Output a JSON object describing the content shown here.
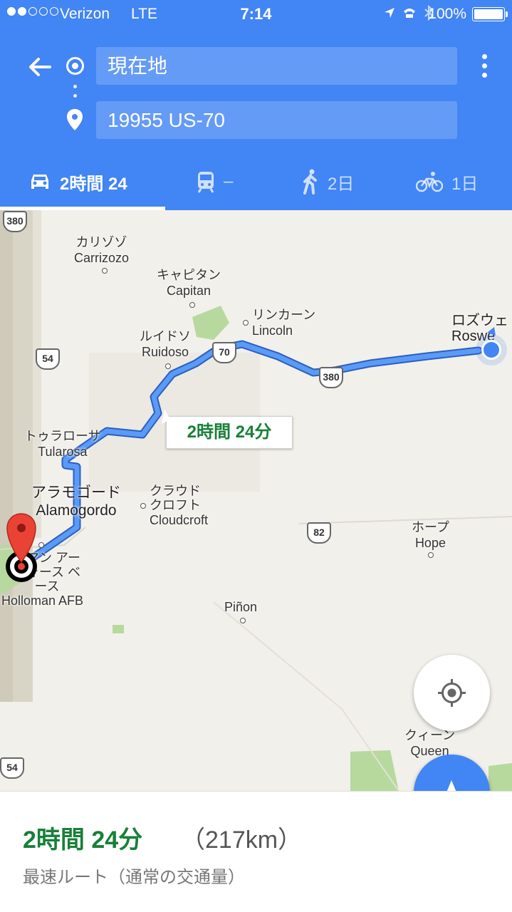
{
  "status_bar": {
    "carrier": "Verizon",
    "network": "LTE",
    "time": "7:14",
    "battery": "100%"
  },
  "header": {
    "origin": "現在地",
    "destination": "19955 US-70"
  },
  "travel_modes": [
    {
      "mode": "drive",
      "icon": "car-icon",
      "label": "2時間 24",
      "active": true
    },
    {
      "mode": "transit",
      "icon": "train-icon",
      "label": "–",
      "active": false
    },
    {
      "mode": "walk",
      "icon": "walk-icon",
      "label": "2日",
      "active": false
    },
    {
      "mode": "bike",
      "icon": "bike-icon",
      "label": "1日",
      "active": false
    }
  ],
  "map": {
    "route_callout": "2時間 24分",
    "places": [
      {
        "jp": "カリゾゾ",
        "en": "Carrizozo"
      },
      {
        "jp": "キャピタン",
        "en": "Capitan"
      },
      {
        "jp": "リンカーン",
        "en": "Lincoln"
      },
      {
        "jp": "ルイドソ",
        "en": "Ruidoso"
      },
      {
        "jp": "ロズウェ",
        "en": "Roswe"
      },
      {
        "jp": "トゥラローサ",
        "en": "Tularosa"
      },
      {
        "jp": "アラモゴード",
        "en": "Alamogordo"
      },
      {
        "jp": "クラウド クロフト",
        "en": "Cloudcroft"
      },
      {
        "jp": "ホープ",
        "en": "Hope"
      },
      {
        "jp": "ーマン アー フォース ベース",
        "en": "Holloman AFB"
      },
      {
        "jp": "",
        "en": "Piñon"
      },
      {
        "jp": "クィーン",
        "en": "Queen"
      }
    ],
    "shields": [
      "380",
      "54",
      "70",
      "380",
      "82",
      "54"
    ]
  },
  "summary": {
    "duration": "2時間 24分",
    "distance": "（217km）",
    "route_note": "最速ルート（通常の交通量）"
  },
  "colors": {
    "header_blue": "#4285f4",
    "route_blue": "#4285f4",
    "duration_green": "#188038",
    "pin_red": "#ea4335"
  }
}
